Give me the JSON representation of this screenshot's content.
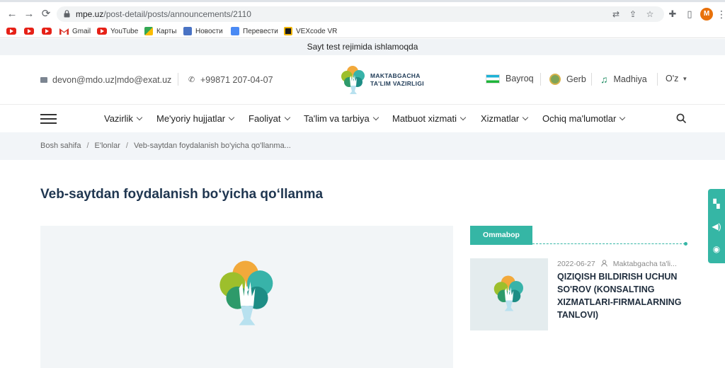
{
  "browser": {
    "back_glyph": "←",
    "forward_glyph": "→",
    "reload_glyph": "⟳",
    "url_host": "mpe.uz",
    "url_path": "/post-detail/posts/announcements/2110",
    "profile_initial": "M",
    "bookmarks": [
      {
        "label": "",
        "icon": "youtube-icon"
      },
      {
        "label": "",
        "icon": "youtube-icon"
      },
      {
        "label": "",
        "icon": "youtube-icon"
      },
      {
        "label": "Gmail",
        "icon": "gmail-icon"
      },
      {
        "label": "YouTube",
        "icon": "youtube-icon"
      },
      {
        "label": "Карты",
        "icon": "maps-icon"
      },
      {
        "label": "Новости",
        "icon": "news-icon"
      },
      {
        "label": "Перевести",
        "icon": "translate-icon"
      },
      {
        "label": "VEXcode VR",
        "icon": "vexcode-icon"
      }
    ]
  },
  "site": {
    "test_banner": "Sayt test rejimida ishlamoqda",
    "email": "devon@mdo.uz|mdo@exat.uz",
    "phone": "+99871 207-04-07",
    "logo_line1": "MAKTABGACHA",
    "logo_line2": "TA'LIM VAZIRLIGI",
    "symbols": {
      "flag": "Bayroq",
      "emblem": "Gerb",
      "anthem": "Madhiya"
    },
    "language": "O'z",
    "nav": [
      "Vazirlik",
      "Me'yoriy hujjatlar",
      "Faoliyat",
      "Ta'lim va tarbiya",
      "Matbuot xizmati",
      "Xizmatlar",
      "Ochiq ma'lumotlar"
    ],
    "breadcrumb": [
      "Bosh sahifa",
      "E'lonlar",
      "Veb-saytdan foydalanish bo'yicha qo'llanma..."
    ],
    "page_title": "Veb-saytdan foydalanish bo‘yicha qo‘llanma",
    "sidebar": {
      "tab_label": "Ommabop",
      "card": {
        "date": "2022-06-27",
        "author": "Maktabgacha ta'li...",
        "title": "QIZIQISH BILDIRISH UCHUN SO'ROV (KONSALTING XIZMATLARI-FIRMALARNING TANLOVI)"
      }
    },
    "accent_color": "#35b6a5",
    "title_color": "#1f3650"
  }
}
